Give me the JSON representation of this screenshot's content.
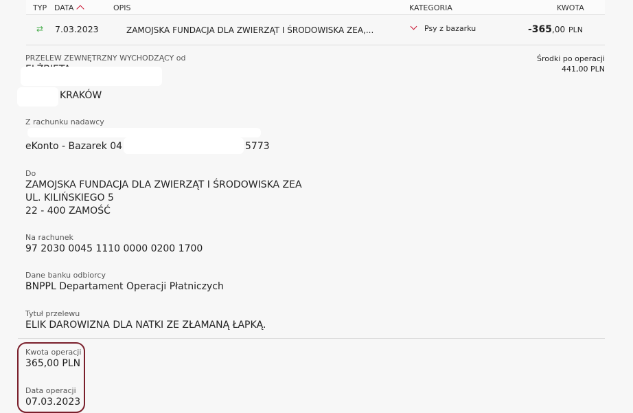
{
  "header": {
    "type": "TYP",
    "date": "DATA",
    "desc": "OPIS",
    "category": "KATEGORIA",
    "amount": "KWOTA"
  },
  "transaction": {
    "date": "7.03.2023",
    "description": "ZAMOJSKA FUNDACJA DLA ZWIERZĄT I ŚRODOWISKA ZEA,...",
    "category": "Psy z bazarku",
    "amount_int": "-365",
    "amount_dec": ",00",
    "currency": "PLN"
  },
  "details": {
    "type_label": "PRZELEW ZEWNĘTRZNY WYCHODZĄCY od",
    "sender_name": "ELŻBIETA",
    "sender_city": "KRAKÓW",
    "balance_label": "Środki po operacji",
    "balance_value": "441,00 PLN",
    "from_account_label": "Z rachunku nadawcy",
    "from_account_prefix": "eKonto - Bazarek 04",
    "from_account_suffix": "5773",
    "to_label": "Do",
    "to_line1": "ZAMOJSKA FUNDACJA DLA ZWIERZĄT I ŚRODOWISKA ZEA",
    "to_line2": "UL. KILIŃSKIEGO 5",
    "to_line3": "22 - 400 ZAMOŚĆ",
    "to_account_label": "Na rachunek",
    "to_account": "97 2030 0045 1110 0000 0200 1700",
    "bank_label": "Dane banku odbiorcy",
    "bank_value": "BNPPL Departament Operacji Płatniczych",
    "title_label": "Tytuł przelewu",
    "title_value": "ELIK DAROWIZNA DLA NATKI ZE ZŁAMANĄ ŁAPKĄ.",
    "amount_label": "Kwota operacji",
    "amount_value": "365,00 PLN",
    "op_date_label": "Data operacji",
    "op_date_value": "07.03.2023"
  },
  "icons": {
    "type": "transfer-arrows-icon",
    "sort": "sort-up-icon",
    "category_toggle": "chevron-down-icon"
  },
  "colors": {
    "accent": "#c8102e",
    "highlight_border": "#7a1f2b",
    "transfer_icon": "#4caf50"
  }
}
